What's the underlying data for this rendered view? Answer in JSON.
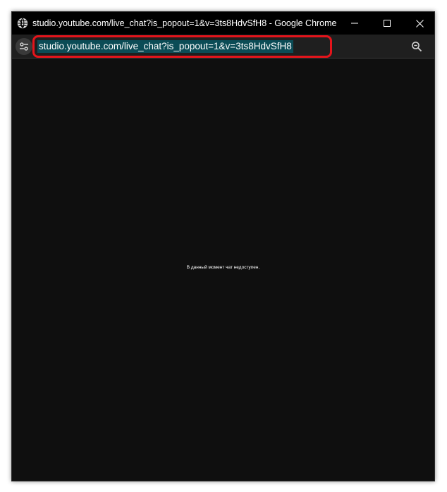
{
  "window": {
    "title": "studio.youtube.com/live_chat?is_popout=1&v=3ts8HdvSfH8 - Google Chrome",
    "controls": {
      "minimize_icon": "minimize-icon",
      "maximize_icon": "maximize-icon",
      "close_icon": "close-icon"
    },
    "app_icon": "globe-icon"
  },
  "addressbar": {
    "url": "studio.youtube.com/live_chat?is_popout=1&v=3ts8HdvSfH8",
    "site_info_icon": "tune-icon",
    "zoom_icon": "zoom-out-icon"
  },
  "content": {
    "message": "В данный момент чат недоступен."
  },
  "colors": {
    "titlebar_bg": "#000000",
    "toolbar_bg": "#1f1f1f",
    "content_bg": "#0f0f0f",
    "url_selection": "#0b4c56",
    "highlight": "#e5141b"
  }
}
